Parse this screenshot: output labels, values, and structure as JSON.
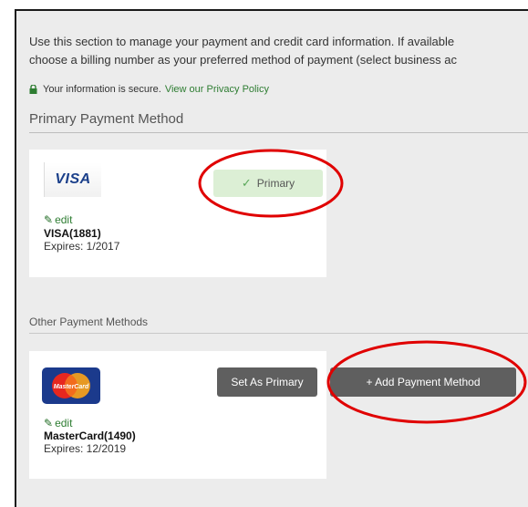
{
  "intro": {
    "line1": "Use this section to manage your payment and credit card information. If available",
    "line2": "choose a billing number as your preferred method of payment (select business ac"
  },
  "secure": {
    "text": "Your information is secure.",
    "link": "View our Privacy Policy"
  },
  "primary_section": {
    "title": "Primary Payment Method",
    "card": {
      "logo": "VISA",
      "badge": "Primary",
      "edit_label": "edit",
      "name": "VISA(1881)",
      "expires": "Expires: 1/2017"
    }
  },
  "other_section": {
    "title": "Other Payment Methods",
    "card": {
      "logo": "MasterCard",
      "set_primary_label": "Set As Primary",
      "edit_label": "edit",
      "name": "MasterCard(1490)",
      "expires": "Expires: 12/2019"
    },
    "add_button": "+ Add Payment Method"
  },
  "colors": {
    "accent_green": "#2e7d32",
    "badge_bg": "#dcefd5",
    "button_bg": "#5f5f5f",
    "annotation_red": "#e00000",
    "panel_bg": "#ececec"
  },
  "icons": [
    "lock-icon",
    "check-icon",
    "pencil-icon",
    "visa-logo",
    "mastercard-logo"
  ]
}
